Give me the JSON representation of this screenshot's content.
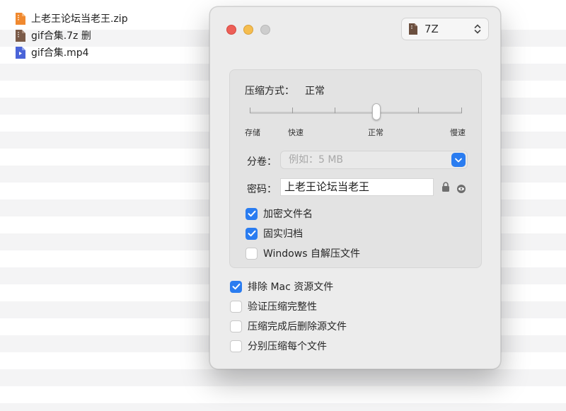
{
  "files": [
    {
      "name": "上老王论坛当老王.zip",
      "icon": "zip-file-icon",
      "color": "#f0892f"
    },
    {
      "name": "gif合集.7z 删",
      "icon": "7z-file-icon",
      "color": "#7a5a48"
    },
    {
      "name": "gif合集.mp4",
      "icon": "video-file-icon",
      "color": "#4a64d8"
    }
  ],
  "dialog": {
    "format": {
      "value": "7Z",
      "icon": "7z-archive-icon"
    },
    "compression": {
      "label": "压缩方式：",
      "value": "正常",
      "levels": [
        "存储",
        "快速",
        "正常",
        "慢速"
      ],
      "selected_level": "正常"
    },
    "volume": {
      "label": "分卷：",
      "placeholder": "例如：5 MB"
    },
    "password": {
      "label": "密码：",
      "value": "上老王论坛当老王"
    },
    "panel_options": [
      {
        "label": "加密文件名",
        "checked": true
      },
      {
        "label": "固实归档",
        "checked": true
      },
      {
        "label": "Windows 自解压文件",
        "checked": false
      }
    ],
    "options": [
      {
        "label": "排除 Mac 资源文件",
        "checked": true
      },
      {
        "label": "验证压缩完整性",
        "checked": false
      },
      {
        "label": "压缩完成后删除源文件",
        "checked": false
      },
      {
        "label": "分别压缩每个文件",
        "checked": false
      }
    ]
  },
  "colors": {
    "accent": "#2a7cf0",
    "close": "#ed5f57",
    "minimize": "#f5bd4f",
    "zoom": "#cdcdcd"
  }
}
